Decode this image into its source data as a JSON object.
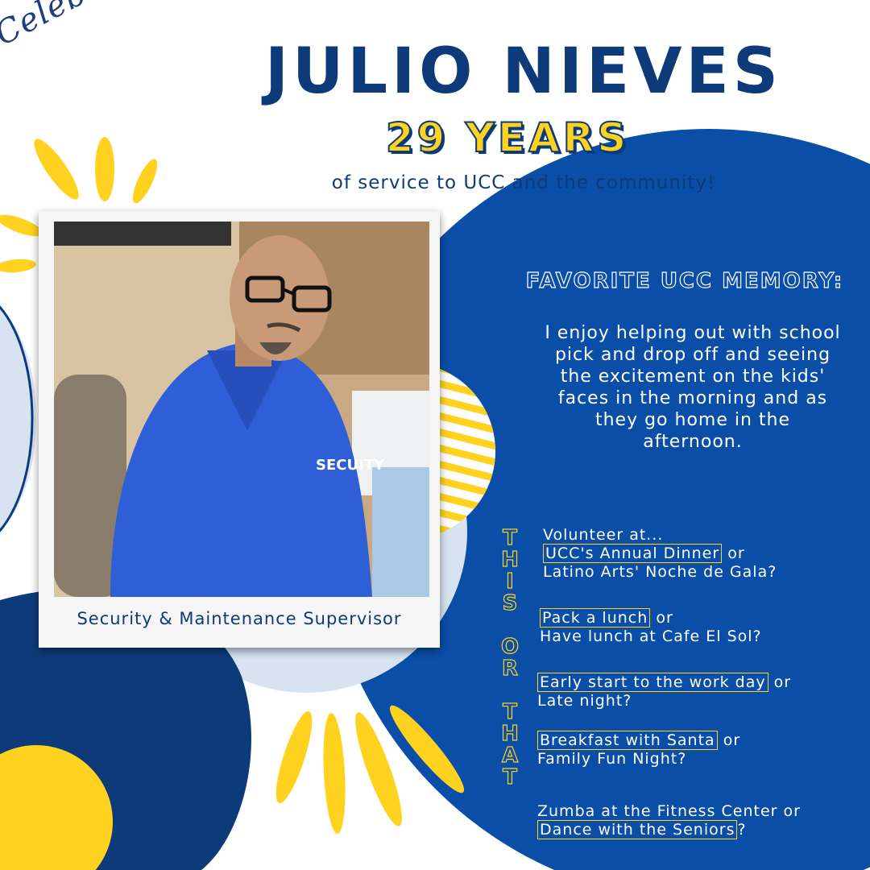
{
  "header": {
    "script_word": "Celebrating...",
    "name": "JULIO NIEVES",
    "years": "29 YEARS",
    "tagline": "of service to UCC and the community!"
  },
  "profile": {
    "caption": "Security & Maintenance Supervisor",
    "shirt_text": "SECUITY"
  },
  "memory": {
    "heading": "FAVORITE UCC MEMORY:",
    "lines": [
      "I enjoy helping out with school",
      "pick and drop off and seeing",
      "the excitement on the kids'",
      "faces in the morning and as",
      "they go home in the",
      "afternoon."
    ]
  },
  "this_or_that": {
    "label_letters": [
      "T",
      "H",
      "I",
      "S",
      "",
      "O",
      "R",
      "",
      "T",
      "H",
      "A",
      "T"
    ],
    "items": [
      {
        "intro": "Volunteer at...",
        "option_a": "UCC's Annual Dinner",
        "connector": "or",
        "option_b": "Latino Arts' Noche de Gala?"
      },
      {
        "option_a": "Pack a lunch",
        "connector": "or",
        "option_b": "Have lunch at Cafe El Sol?"
      },
      {
        "option_a": "Early start to the work day",
        "connector": "or",
        "option_b": "Late night?"
      },
      {
        "option_a": "Breakfast with Santa",
        "connector": "or",
        "option_b": "Family Fun Night?"
      },
      {
        "option_a": "Zumba at the Fitness Center or",
        "option_b": "Dance with the Seniors",
        "suffix": "?"
      }
    ]
  },
  "colors": {
    "navy": "#0d3b7a",
    "blue": "#0a4ea8",
    "yellow": "#ffd21f",
    "light_blue": "#d8e3f2"
  }
}
